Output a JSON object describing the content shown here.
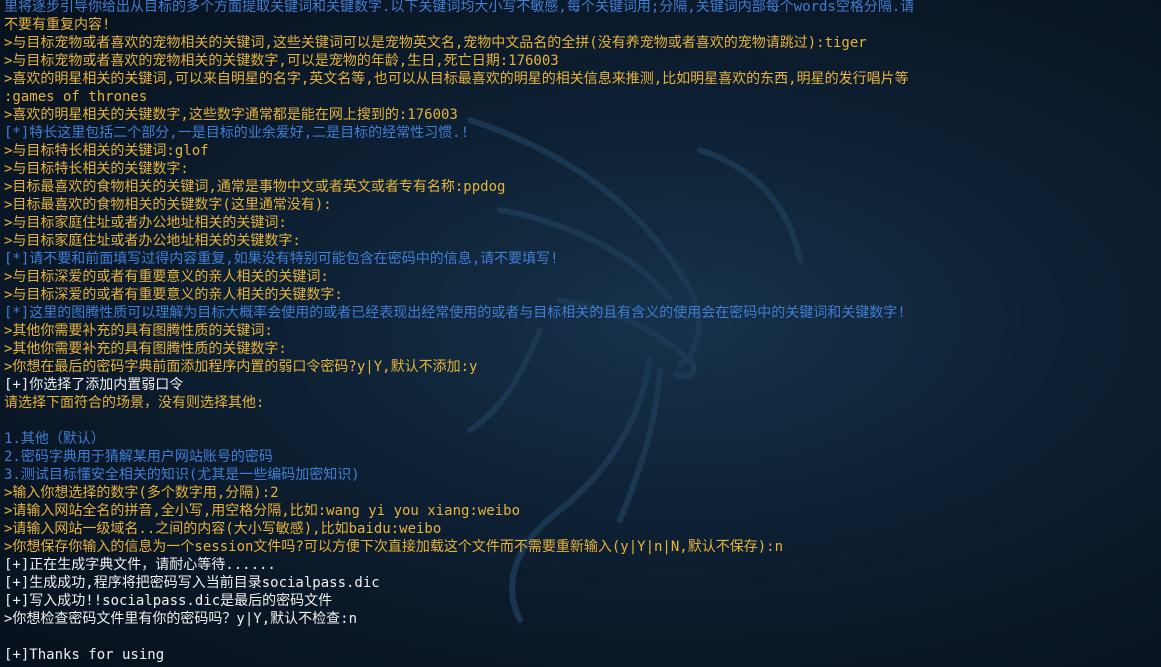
{
  "colors": {
    "prompt_text": "#e6b33a",
    "info_text": "#3f7ed3",
    "status_text": "#f0f0f0",
    "background": "#0b1a2a"
  },
  "terminal": {
    "lines": [
      {
        "color": "blue",
        "text": "里将逐步引导你给出从目标的多个方面提取关键词和关键数字.以下关键词均大小写不敏感,每个关键词用;分隔,关键词内部每个words空格分隔.请"
      },
      {
        "color": "orange",
        "text": "不要有重复内容!"
      },
      {
        "color": "orange",
        "text": ">与目标宠物或者喜欢的宠物相关的关键词,这些关键词可以是宠物英文名,宠物中文品名的全拼(没有养宠物或者喜欢的宠物请跳过):tiger"
      },
      {
        "color": "orange",
        "text": ">与目标宠物或者喜欢的宠物相关的关键数字,可以是宠物的年龄,生日,死亡日期:176003"
      },
      {
        "color": "orange",
        "text": ">喜欢的明星相关的关键词,可以来自明星的名字,英文名等,也可以从目标最喜欢的明星的相关信息来推测,比如明星喜欢的东西,明星的发行唱片等"
      },
      {
        "color": "orange",
        "text": ":games of thrones"
      },
      {
        "color": "orange",
        "text": ">喜欢的明星相关的关键数字,这些数字通常都是能在网上搜到的:176003"
      },
      {
        "color": "blue",
        "text": "[*]特长这里包括二个部分,一是目标的业余爱好,二是目标的经常性习惯.!"
      },
      {
        "color": "orange",
        "text": ">与目标特长相关的关键词:glof"
      },
      {
        "color": "orange",
        "text": ">与目标特长相关的关键数字:"
      },
      {
        "color": "orange",
        "text": ">目标最喜欢的食物相关的关键词,通常是事物中文或者英文或者专有名称:ppdog"
      },
      {
        "color": "orange",
        "text": ">目标最喜欢的食物相关的关键数字(这里通常没有):"
      },
      {
        "color": "orange",
        "text": ">与目标家庭住址或者办公地址相关的关键词:"
      },
      {
        "color": "orange",
        "text": ">与目标家庭住址或者办公地址相关的关键数字:"
      },
      {
        "color": "blue",
        "text": "[*]请不要和前面填写过得内容重复,如果没有特别可能包含在密码中的信息,请不要填写!"
      },
      {
        "color": "orange",
        "text": ">与目标深爱的或者有重要意义的亲人相关的关键词:"
      },
      {
        "color": "orange",
        "text": ">与目标深爱的或者有重要意义的亲人相关的关键数字:"
      },
      {
        "color": "blue",
        "text": "[*]这里的图腾性质可以理解为目标大概率会使用的或者已经表现出经常使用的或者与目标相关的且有含义的使用会在密码中的关键词和关键数字!"
      },
      {
        "color": "orange",
        "text": ">其他你需要补充的具有图腾性质的关键词:"
      },
      {
        "color": "orange",
        "text": ">其他你需要补充的具有图腾性质的关键数字:"
      },
      {
        "color": "orange",
        "text": ">你想在最后的密码字典前面添加程序内置的弱口令密码?y|Y,默认不添加:y"
      },
      {
        "color": "white",
        "text": "[+]你选择了添加内置弱口令"
      },
      {
        "color": "orange",
        "text": "请选择下面符合的场景，没有则选择其他:"
      },
      {
        "color": "blank",
        "text": ""
      },
      {
        "color": "blue",
        "text": "1.其他（默认）"
      },
      {
        "color": "blue",
        "text": "2.密码字典用于猜解某用户网站账号的密码"
      },
      {
        "color": "blue",
        "text": "3.测试目标懂安全相关的知识(尤其是一些编码加密知识)"
      },
      {
        "color": "orange",
        "text": ">输入你想选择的数字(多个数字用,分隔):2"
      },
      {
        "color": "orange",
        "text": ">请输入网站全名的拼音,全小写,用空格分隔,比如:wang yi you xiang:weibo"
      },
      {
        "color": "orange",
        "text": ">请输入网站一级域名..之间的内容(大小写敏感),比如baidu:weibo"
      },
      {
        "color": "orange",
        "text": ">你想保存你输入的信息为一个session文件吗?可以方便下次直接加载这个文件而不需要重新输入(y|Y|n|N,默认不保存):n"
      },
      {
        "color": "white",
        "text": "[+]正在生成字典文件，请耐心等待......"
      },
      {
        "color": "white",
        "text": "[+]生成成功,程序将把密码写入当前目录socialpass.dic"
      },
      {
        "color": "white",
        "text": "[+]写入成功!!socialpass.dic是最后的密码文件"
      },
      {
        "color": "white",
        "text": ">你想检查密码文件里有你的密码吗？y|Y,默认不检查:n"
      },
      {
        "color": "blank",
        "text": ""
      },
      {
        "color": "white",
        "text": "[+]Thanks for using"
      }
    ]
  }
}
